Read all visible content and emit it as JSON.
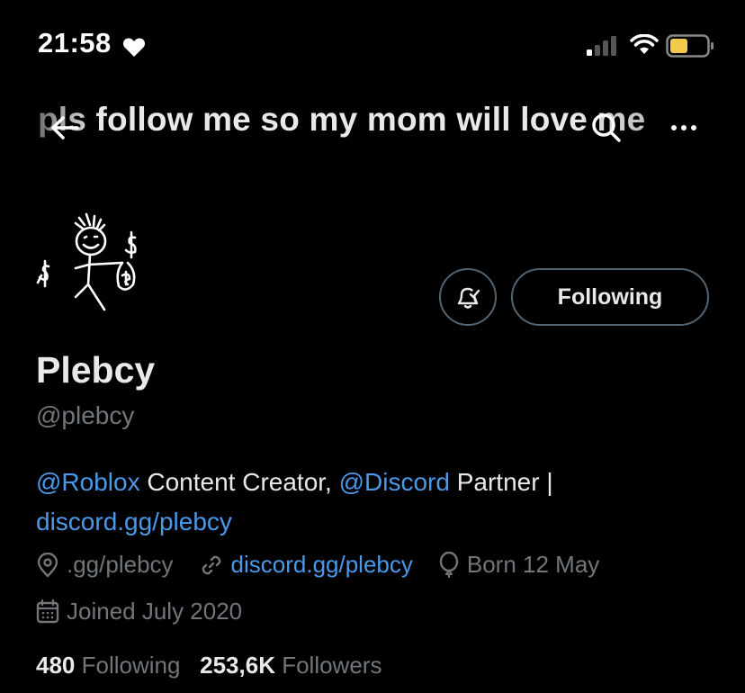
{
  "status_bar": {
    "time": "21:58"
  },
  "header": {
    "title": "pls follow me so my mom will love me"
  },
  "actions": {
    "follow_label": "Following"
  },
  "profile": {
    "name": "Plebcy",
    "handle": "@plebcy",
    "bio": {
      "mention1": "@Roblox",
      "text1": " Content Creator, ",
      "mention2": "@Discord",
      "text2": " Partner |",
      "link": "discord.gg/plebcy"
    },
    "location": ".gg/plebcy",
    "website": "discord.gg/plebcy",
    "birthday": "Born 12 May",
    "joined": "Joined July 2020"
  },
  "stats": {
    "following_count": "480",
    "following_label": "Following",
    "followers_count": "253,6K",
    "followers_label": "Followers"
  },
  "colors": {
    "link": "#4a99e9",
    "muted": "#71767b",
    "text": "#e7e9ea",
    "battery": "#f2c94c"
  }
}
